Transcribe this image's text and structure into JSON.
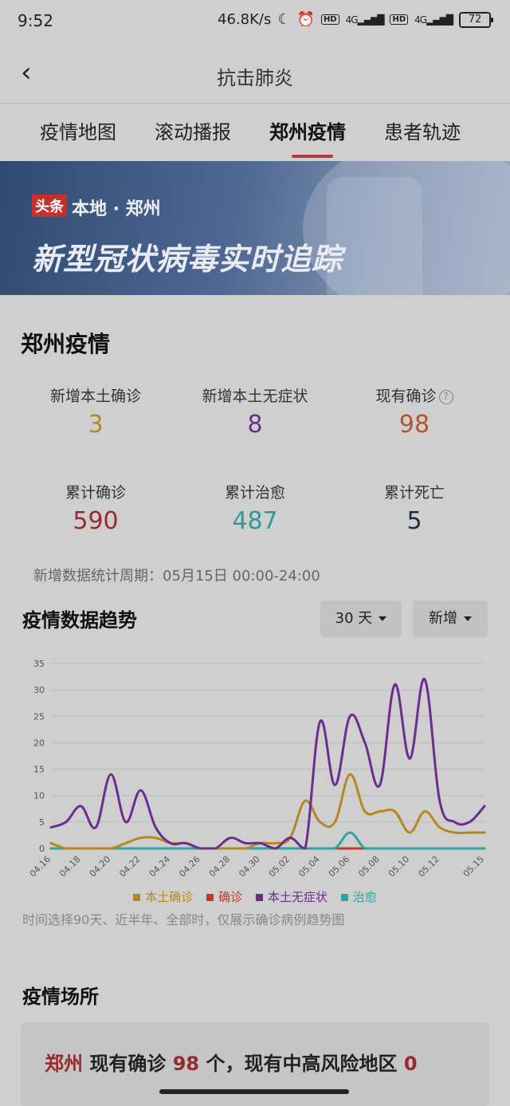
{
  "status": {
    "time": "9:52",
    "speed": "46.8K/s",
    "battery": "72",
    "network": "4G",
    "hd_label": "HD"
  },
  "header": {
    "title": "抗击肺炎",
    "back_icon": "chevron-left-icon"
  },
  "tabs": [
    {
      "label": "疫情地图"
    },
    {
      "label": "滚动播报"
    },
    {
      "label": "郑州疫情",
      "active": true
    },
    {
      "label": "患者轨迹"
    }
  ],
  "banner": {
    "tag": "头条",
    "local": "本地 · 郑州",
    "slogan": "新型冠状病毒实时追踪"
  },
  "section": {
    "title": "郑州疫情",
    "stats": [
      {
        "label": "新增本土确诊",
        "value": "3",
        "color": "#b8871f"
      },
      {
        "label": "新增本土无症状",
        "value": "8",
        "color": "#6b2e8f"
      },
      {
        "label": "现有确诊",
        "value": "98",
        "color": "#b0572a",
        "help": "?"
      },
      {
        "label": "累计确诊",
        "value": "590",
        "color": "#962a2d"
      },
      {
        "label": "累计治愈",
        "value": "487",
        "color": "#2f9a96"
      },
      {
        "label": "累计死亡",
        "value": "5",
        "color": "#1f2d3d"
      }
    ],
    "period": "新增数据统计周期：05月15日 00:00-24:00"
  },
  "trend": {
    "title": "疫情数据趋势",
    "range_label": "30 天",
    "mode_label": "新增",
    "note": "时间选择90天、近半年、全部时，仅展示确诊病例趋势图"
  },
  "chart_data": {
    "type": "line",
    "ylim": [
      0,
      35
    ],
    "yticks": [
      "0",
      "5",
      "10",
      "15",
      "20",
      "25",
      "30",
      "35"
    ],
    "x_tick_labels": [
      "04.16",
      "04.18",
      "04.20",
      "04.22",
      "04.24",
      "04.26",
      "04.28",
      "04.30",
      "05.02",
      "05.04",
      "05.06",
      "05.08",
      "05.10",
      "05.12",
      "05.15"
    ],
    "x": [
      "04.16",
      "04.17",
      "04.18",
      "04.19",
      "04.20",
      "04.21",
      "04.22",
      "04.23",
      "04.24",
      "04.25",
      "04.26",
      "04.27",
      "04.28",
      "04.29",
      "04.30",
      "05.01",
      "05.02",
      "05.03",
      "05.04",
      "05.05",
      "05.06",
      "05.07",
      "05.08",
      "05.09",
      "05.10",
      "05.11",
      "05.12",
      "05.13",
      "05.14",
      "05.15"
    ],
    "series": [
      {
        "name": "本土确诊",
        "color": "#b8871f",
        "values": [
          1,
          0,
          0,
          0,
          0,
          1,
          2,
          2,
          1,
          1,
          0,
          0,
          0,
          0,
          1,
          1,
          2,
          9,
          5,
          5,
          14,
          7,
          7,
          7,
          3,
          7,
          4,
          3,
          3,
          3
        ]
      },
      {
        "name": "确诊",
        "color": "#c0392b",
        "values": [
          0,
          0,
          0,
          0,
          0,
          0,
          0,
          0,
          0,
          0,
          0,
          0,
          0,
          0,
          0,
          0,
          0,
          0,
          0,
          0,
          0,
          0,
          0,
          0,
          0,
          0,
          0,
          0,
          0,
          0
        ]
      },
      {
        "name": "本土无症状",
        "color": "#6b2e8f",
        "values": [
          4,
          5,
          8,
          4,
          14,
          5,
          11,
          4,
          1,
          1,
          0,
          0,
          2,
          1,
          1,
          0,
          2,
          0,
          24,
          12,
          25,
          20,
          12,
          31,
          17,
          32,
          9,
          5,
          5,
          8
        ]
      },
      {
        "name": "治愈",
        "color": "#2fa39e",
        "values": [
          0,
          0,
          0,
          0,
          0,
          0,
          0,
          0,
          0,
          0,
          0,
          0,
          0,
          0,
          0,
          0,
          0,
          0,
          0,
          0,
          3,
          0,
          0,
          0,
          0,
          0,
          0,
          0,
          0,
          0
        ]
      }
    ]
  },
  "venue": {
    "title": "疫情场所",
    "city": "郑州",
    "text1": "现有确诊",
    "count": "98",
    "text2": "个，现有中高风险地区",
    "risk": "0"
  }
}
